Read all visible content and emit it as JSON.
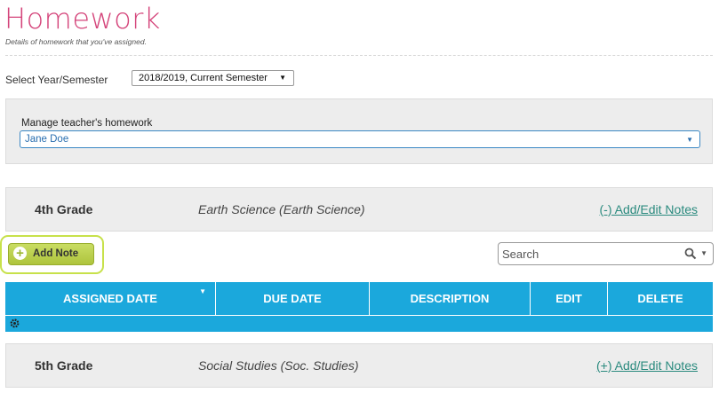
{
  "header": {
    "title": "Homework",
    "subtitle": "Details of homework that you've assigned."
  },
  "year_filter": {
    "label": "Select Year/Semester",
    "selected": "2018/2019, Current Semester"
  },
  "manage": {
    "label": "Manage teacher's homework",
    "selected_teacher": "Jane Doe"
  },
  "grades": [
    {
      "name": "4th Grade",
      "subject": "Earth Science (Earth Science)",
      "notes_link": "(-) Add/Edit Notes"
    },
    {
      "name": "5th Grade",
      "subject": "Social Studies (Soc. Studies)",
      "notes_link": "(+) Add/Edit Notes"
    }
  ],
  "toolbar": {
    "add_note_label": "Add Note",
    "search_placeholder": "Search"
  },
  "table": {
    "columns": [
      "ASSIGNED DATE",
      "DUE DATE",
      "DESCRIPTION",
      "EDIT",
      "DELETE"
    ]
  },
  "colors": {
    "title": "#d4447a",
    "table_header": "#1ba8dc",
    "add_note": "#b7cf47",
    "link": "#2a8a7e"
  }
}
